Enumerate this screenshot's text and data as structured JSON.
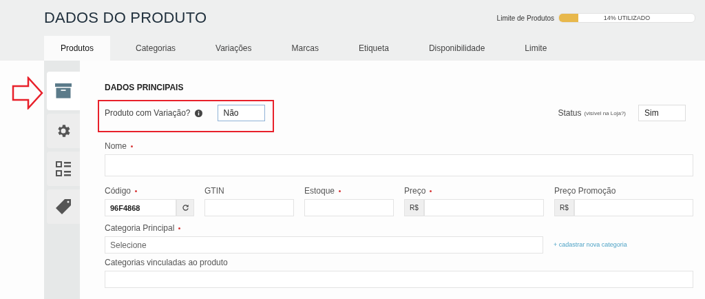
{
  "header": {
    "title": "DADOS DO PRODUTO",
    "limit": {
      "label": "Limite de Produtos",
      "level": 0.14,
      "reading": "14% UTILIZADO"
    }
  },
  "tabs": [
    {
      "label": "Produtos",
      "selected": true
    },
    {
      "label": "Categorias",
      "selected": false
    },
    {
      "label": "Variações",
      "selected": false
    },
    {
      "label": "Marcas",
      "selected": false
    },
    {
      "label": "Etiqueta",
      "selected": false
    },
    {
      "label": "Disponibilidade",
      "selected": false
    },
    {
      "label": "Limite",
      "selected": false
    }
  ],
  "side_tabs": [
    {
      "kind": "box",
      "selected": true
    },
    {
      "kind": "gear",
      "selected": false
    },
    {
      "kind": "list",
      "selected": false
    },
    {
      "kind": "tag",
      "selected": false
    }
  ],
  "section_title": "DADOS PRINCIPAIS",
  "variation": {
    "label": "Produto com Variação?",
    "value": "Não"
  },
  "status": {
    "label": "Status",
    "note": "(visível na Loja?)",
    "value": "Sim"
  },
  "name_field": {
    "label": "Nome",
    "required": true
  },
  "row_fields": [
    {
      "label": "Código",
      "required": true,
      "kind": "refresh",
      "value": "96F4868"
    },
    {
      "label": "GTIN",
      "required": false,
      "kind": "plain"
    },
    {
      "label": "Estoque",
      "required": true,
      "kind": "plain"
    },
    {
      "label": "Preço",
      "required": true,
      "kind": "currency",
      "prefix": "R$"
    },
    {
      "label": "Preço Promoção",
      "required": false,
      "kind": "currency",
      "prefix": "R$"
    }
  ],
  "main_category": {
    "label": "Categoria Principal",
    "required": true,
    "placeholder": "Selecione",
    "link": "+ cadastrar nova categoria"
  },
  "linked_categories": {
    "label": "Categorias vinculadas ao produto"
  }
}
